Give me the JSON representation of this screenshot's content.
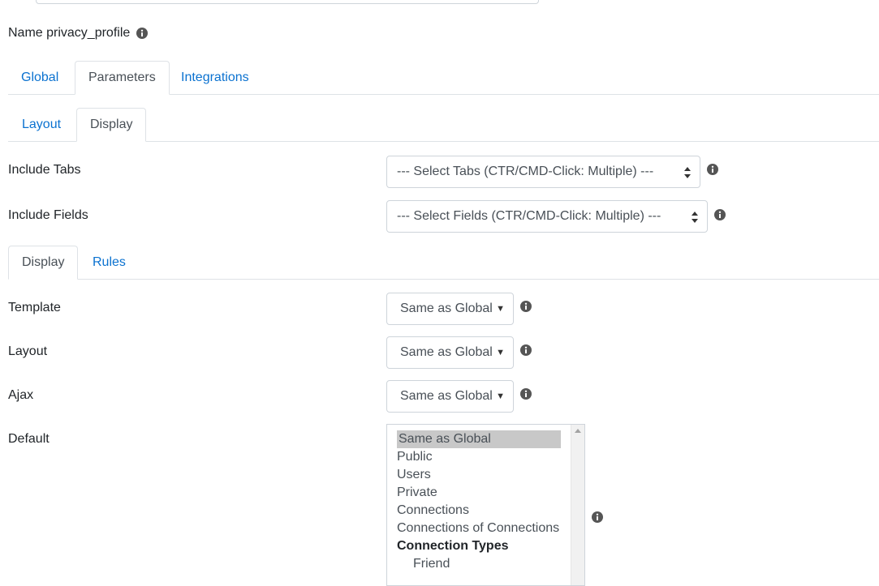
{
  "name_row": {
    "label": "Name privacy_profile"
  },
  "main_tabs": [
    {
      "label": "Global",
      "active": false
    },
    {
      "label": "Parameters",
      "active": true
    },
    {
      "label": "Integrations",
      "active": false
    }
  ],
  "sub_tabs": [
    {
      "label": "Layout",
      "active": false
    },
    {
      "label": "Display",
      "active": true
    }
  ],
  "include_tabs": {
    "label": "Include Tabs",
    "value": "--- Select Tabs (CTR/CMD-Click: Multiple) ---"
  },
  "include_fields": {
    "label": "Include Fields",
    "value": "--- Select Fields (CTR/CMD-Click: Multiple) ---"
  },
  "display_tabs": [
    {
      "label": "Display",
      "active": true
    },
    {
      "label": "Rules",
      "active": false
    }
  ],
  "template": {
    "label": "Template",
    "value": "Same as Global"
  },
  "layout": {
    "label": "Layout",
    "value": "Same as Global"
  },
  "ajax": {
    "label": "Ajax",
    "value": "Same as Global"
  },
  "default": {
    "label": "Default",
    "options": [
      "Same as Global",
      "Public",
      "Users",
      "Private",
      "Connections",
      "Connections of Connections",
      "Connection Types",
      "Friend"
    ]
  },
  "colors": {
    "link": "#0b72d0",
    "border": "#dee2e6",
    "selected_option": "#c8c8c8"
  }
}
